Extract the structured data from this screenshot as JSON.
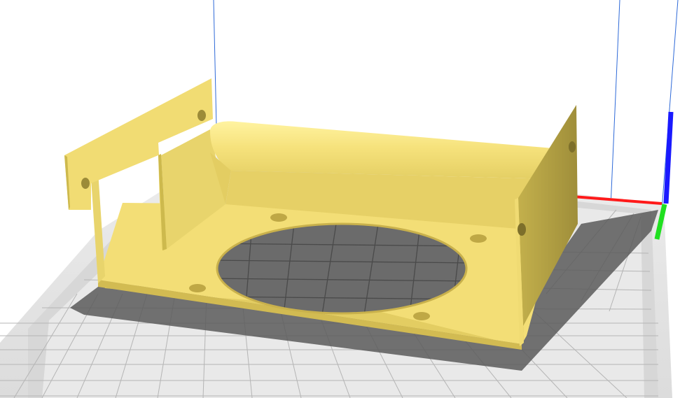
{
  "viewport": {
    "background_color": "#ffffff",
    "build_plate": {
      "outer_color": "#e6e6e6",
      "border_color": "#d8d8d8",
      "grid_line_color": "#b5b5b5",
      "shadow_color": "#5a5a5a"
    },
    "model": {
      "color": "#f6e27c",
      "shade_color": "#cdb94d",
      "dark_shade_color": "#9c8b38"
    },
    "axes": {
      "x_color": "#ff1a1a",
      "y_color": "#20e020",
      "z_color": "#1a1aff"
    },
    "volume_edge_color": "#2f6ad8"
  }
}
